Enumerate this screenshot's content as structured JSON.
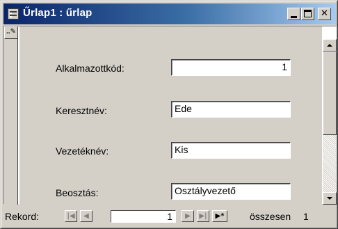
{
  "window": {
    "title": "Űrlap1 : űrlap",
    "title_icon": "form-icon",
    "controls": {
      "minimize_icon": "minimize-icon",
      "maximize_icon": "maximize-icon",
      "close_icon": "close-icon",
      "close_glyph": "✕"
    }
  },
  "record_selector": {
    "glyph": "..✎"
  },
  "form": {
    "fields": [
      {
        "label": "Alkalmazottkód:",
        "value": "1",
        "align": "right"
      },
      {
        "label": "Keresztnév:",
        "value": "Ede",
        "align": "left"
      },
      {
        "label": "Vezetéknév:",
        "value": "Kis",
        "align": "left"
      },
      {
        "label": "Beosztás:",
        "value": "Osztályvezető",
        "align": "left"
      }
    ]
  },
  "navigation": {
    "label": "Rekord:",
    "first_glyph": "|◀",
    "prev_glyph": "◀",
    "current": "1",
    "next_glyph": "▶",
    "last_glyph": "▶|",
    "new_glyph": "▶*",
    "total_label": "összesen",
    "total": "1"
  },
  "colors": {
    "title_start": "#0a246a",
    "title_end": "#a6caf0",
    "face": "#d4d0c8"
  }
}
